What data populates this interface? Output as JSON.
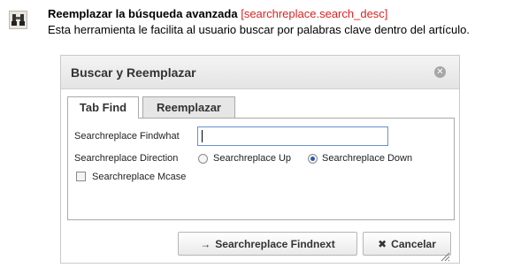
{
  "header": {
    "title": "Reemplazar la búsqueda avanzada",
    "key": "[searchreplace.search_desc]",
    "description": "Esta herramienta le facilita al usuario buscar por palabras clave dentro del artículo.",
    "icon": "binoculars-icon"
  },
  "dialog": {
    "title": "Buscar y Reemplazar",
    "close_icon": "close-icon",
    "tabs": [
      {
        "label": "Tab Find",
        "active": true
      },
      {
        "label": "Reemplazar",
        "active": false
      }
    ],
    "fields": {
      "findwhat_label": "Searchreplace Findwhat",
      "findwhat_value": "",
      "direction_label": "Searchreplace Direction",
      "direction_up_label": "Searchreplace Up",
      "direction_down_label": "Searchreplace Down",
      "direction_selected": "down",
      "mcase_label": "Searchreplace Mcase",
      "mcase_checked": false
    },
    "buttons": {
      "findnext_label": "Searchreplace Findnext",
      "findnext_icon": "arrow-right-icon",
      "cancel_label": "Cancelar",
      "cancel_icon": "x-icon"
    }
  },
  "colors": {
    "key_red": "#e02020",
    "input_border": "#6b8fcf",
    "radio_selected": "#2a5aa8"
  }
}
